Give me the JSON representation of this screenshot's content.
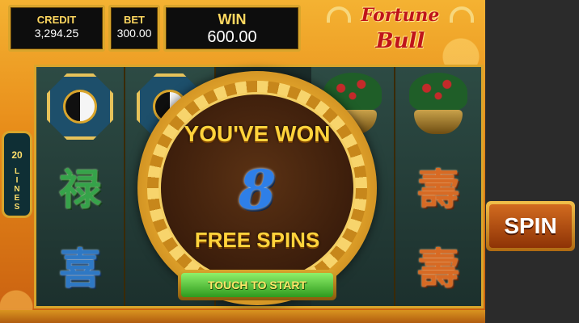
{
  "hud": {
    "credit_label": "CREDIT",
    "credit_value": "3,294.25",
    "bet_label": "BET",
    "bet_value": "300.00",
    "win_label": "WIN",
    "win_value": "600.00"
  },
  "logo": {
    "line1": "Fortune",
    "line2": "Bull"
  },
  "lines": {
    "count": "20",
    "word": [
      "L",
      "I",
      "N",
      "E",
      "S"
    ]
  },
  "reels": {
    "symbols": [
      "禄",
      "喜",
      "壽",
      "壽"
    ]
  },
  "popup": {
    "title": "YOU'VE WON",
    "count": "8",
    "subtitle": "FREE SPINS",
    "button": "TOUCH TO START"
  },
  "controls": {
    "spin": "SPIN"
  },
  "colors": {
    "gold": "#d9a52c",
    "free_spin_number": "#2e7fe8",
    "touch_button": "#2e9a1e"
  }
}
